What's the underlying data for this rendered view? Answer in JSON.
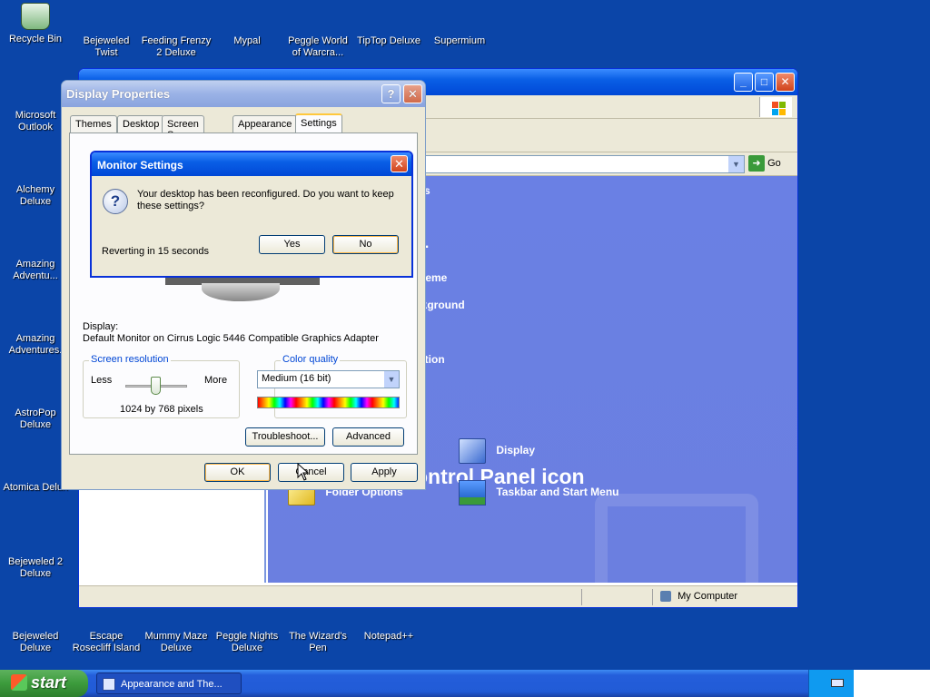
{
  "desktop_icons": [
    {
      "label": "Recycle Bin",
      "icon": "recycle-bin-icon"
    },
    {
      "label": "Bejeweled Twist",
      "icon": "game-icon"
    },
    {
      "label": "Feeding Frenzy 2 Deluxe",
      "icon": "game-icon"
    },
    {
      "label": "Mypal",
      "icon": "browser-icon"
    },
    {
      "label": "Peggle World of Warcra...",
      "icon": "game-icon"
    },
    {
      "label": "TipTop Deluxe",
      "icon": "game-icon"
    },
    {
      "label": "Supermium",
      "icon": "browser-icon"
    },
    {
      "label": "Microsoft Outlook",
      "icon": "outlook-icon"
    },
    {
      "label": "Alchemy Deluxe",
      "icon": "game-icon"
    },
    {
      "label": "Amazing Adventu...",
      "icon": "game-icon"
    },
    {
      "label": "Amazing Adventures.",
      "icon": "game-icon"
    },
    {
      "label": "AstroPop Deluxe",
      "icon": "game-icon"
    },
    {
      "label": "Atomica Delux",
      "icon": "game-icon"
    },
    {
      "label": "Bejeweled 2 Deluxe",
      "icon": "game-icon"
    },
    {
      "label": "Bejeweled Deluxe",
      "icon": "game-icon"
    },
    {
      "label": "Escape Rosecliff Island",
      "icon": "game-icon"
    },
    {
      "label": "Mummy Maze Deluxe",
      "icon": "game-icon"
    },
    {
      "label": "Peggle Nights Deluxe",
      "icon": "game-icon"
    },
    {
      "label": "The Wizard's Pen",
      "icon": "game-icon"
    },
    {
      "label": "Notepad++",
      "icon": "notepad-icon"
    }
  ],
  "control_panel": {
    "address_go": "Go",
    "tasks": [
      "nes",
      "…",
      "theme",
      "ckground",
      "lution"
    ],
    "pick_heading": "ontrol Panel icon",
    "items": [
      {
        "label": "Display",
        "icon": "display-icon"
      },
      {
        "label": "Folder Options",
        "icon": "folder-options-icon"
      },
      {
        "label": "Taskbar and Start Menu",
        "icon": "taskbar-icon"
      }
    ],
    "status_computer": "My Computer"
  },
  "display_properties": {
    "title": "Display Properties",
    "help_btn": "?",
    "close_btn": "✕",
    "tabs": [
      "Themes",
      "Desktop",
      "Screen Saver",
      "Appearance",
      "Settings"
    ],
    "active_tab": "Settings",
    "display_label": "Display:",
    "display_value": "Default Monitor on Cirrus Logic 5446 Compatible Graphics Adapter",
    "resolution": {
      "group_title": "Screen resolution",
      "less": "Less",
      "more": "More",
      "value": "1024 by 768 pixels"
    },
    "color": {
      "group_title": "Color quality",
      "selected": "Medium (16 bit)"
    },
    "troubleshoot_btn": "Troubleshoot...",
    "advanced_btn": "Advanced",
    "ok_btn": "OK",
    "cancel_btn": "Cancel",
    "apply_btn": "Apply"
  },
  "monitor_settings": {
    "title": "Monitor Settings",
    "message": "Your desktop has been reconfigured.  Do you want to keep these settings?",
    "reverting": "Reverting in 15 seconds",
    "yes_btn": "Yes",
    "no_btn": "No"
  },
  "taskbar": {
    "start_label": "start",
    "window_button": "Appearance and The..."
  }
}
